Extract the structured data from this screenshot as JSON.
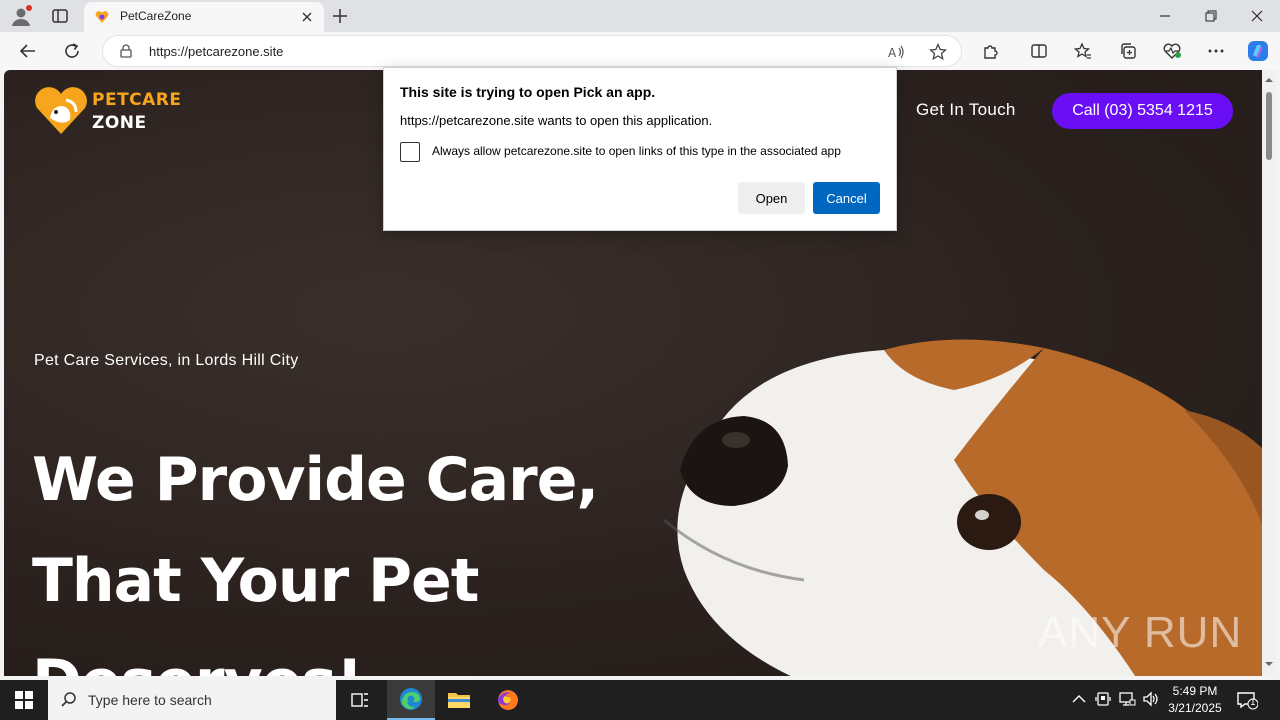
{
  "browser": {
    "tab_title": "PetCareZone",
    "url": "https://petcarezone.site"
  },
  "site": {
    "logo_line1": "PETCARE",
    "logo_line2": "ZONE",
    "nav_contact": "Get In Touch",
    "call_button": "Call (03) 5354 1215",
    "tagline": "Pet Care Services, in Lords Hill City",
    "hero_line1": "We Provide Care,",
    "hero_line2": "That Your Pet",
    "hero_line3": "Deserves!",
    "colors": {
      "accent": "#6a0ff5",
      "logo_orange": "#f7a51c",
      "background": "#2a211e"
    }
  },
  "dialog": {
    "title": "This site is trying to open Pick an app.",
    "message": "https://petcarezone.site wants to open this application.",
    "checkbox_label": "Always allow petcarezone.site to open links of this type in the associated app",
    "checkbox_checked": false,
    "open_label": "Open",
    "cancel_label": "Cancel"
  },
  "watermark": "ANY RUN",
  "taskbar": {
    "search_placeholder": "Type here to search",
    "time": "5:49 PM",
    "date": "3/21/2025",
    "notification_count": "1"
  }
}
